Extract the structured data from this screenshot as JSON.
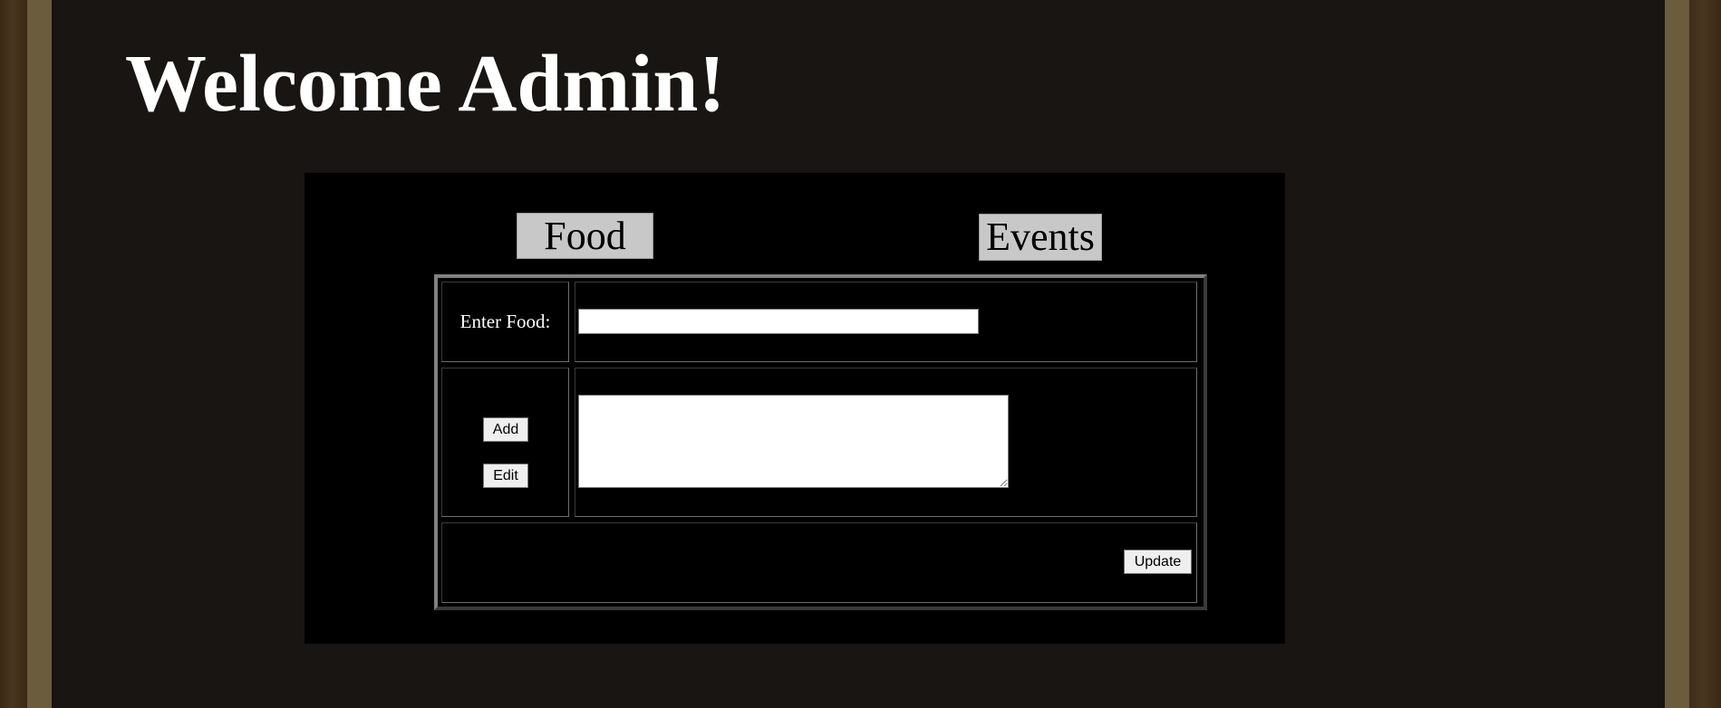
{
  "header": {
    "title": "Welcome Admin!"
  },
  "tabs": [
    {
      "label": "Food"
    },
    {
      "label": "Events"
    }
  ],
  "form": {
    "enter_food_label": "Enter Food:",
    "food_input_value": "",
    "food_textarea_value": "",
    "add_label": "Add",
    "edit_label": "Edit",
    "update_label": "Update"
  },
  "colors": {
    "page_background": "#181512",
    "frame_gold": "#6b5c3e",
    "content_background": "#000000",
    "tab_background": "#c8c8c8",
    "text_light": "#ffffff"
  }
}
